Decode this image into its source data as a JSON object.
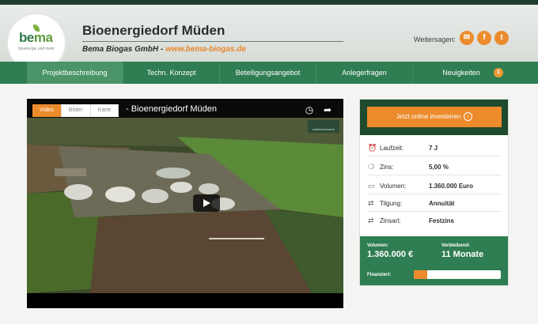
{
  "header": {
    "logo_text_main": "be",
    "logo_text_accent": "ma",
    "logo_subtitle": "bioenergie und mehr",
    "title": "Bioenergiedorf Müden",
    "company": "Bema Biogas GmbH",
    "separator": " - ",
    "url": "www.bema-biogas.de",
    "share_label": "Weitersagen:",
    "share_buttons": [
      {
        "icon": "email-icon",
        "glyph": "✉"
      },
      {
        "icon": "facebook-icon",
        "glyph": "f"
      },
      {
        "icon": "twitter-icon",
        "glyph": "t"
      }
    ]
  },
  "nav": {
    "items": [
      {
        "label": "Projektbeschreibung",
        "active": true
      },
      {
        "label": "Techn. Konzept",
        "active": false
      },
      {
        "label": "Beteiligungsangebot",
        "active": false
      },
      {
        "label": "Anlegerfragen",
        "active": false
      },
      {
        "label": "Neuigkeiten",
        "active": false
      }
    ],
    "news_badge": "1"
  },
  "video": {
    "title": "- Bioenergiedorf Müden",
    "tabs": [
      {
        "label": "Video",
        "active": true
      },
      {
        "label": "Bilder",
        "active": false
      },
      {
        "label": "Karte",
        "active": false
      }
    ],
    "channel_logo_text": "schlieckermann"
  },
  "panel": {
    "invest_button": "Jetzt online investieren",
    "facts": [
      {
        "icon": "clock-icon",
        "glyph": "⏰",
        "label": "Laufzeit:",
        "value": "7 J"
      },
      {
        "icon": "piggy-bank-icon",
        "glyph": "❍",
        "label": "Zins:",
        "value": "5,00 %"
      },
      {
        "icon": "money-icon",
        "glyph": "▭",
        "label": "Volumen:",
        "value": "1.360.000 Euro"
      },
      {
        "icon": "repeat-icon",
        "glyph": "⇄",
        "label": "Tilgung:",
        "value": "Annuität"
      },
      {
        "icon": "repeat-icon",
        "glyph": "⇄",
        "label": "Zinsart:",
        "value": "Festzins"
      }
    ],
    "funding": {
      "volume_label": "Volumen:",
      "volume_value": "1.360.000 €",
      "remaining_label": "Verbleibend:",
      "remaining_value": "11 Monate",
      "financed_label": "Finanziert:",
      "financed_fraction": 0.15
    }
  },
  "colors": {
    "brand_green": "#2f7d52",
    "dark_green": "#1e4a2e",
    "accent_orange": "#ec8b2c"
  }
}
